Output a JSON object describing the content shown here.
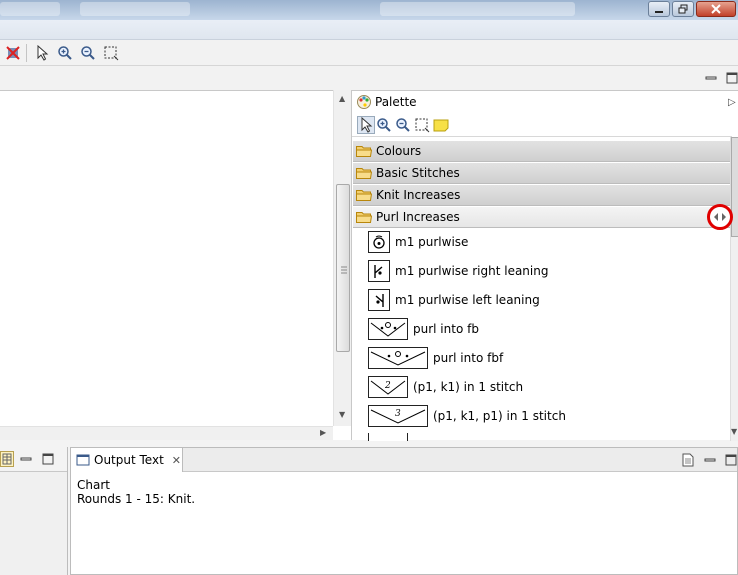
{
  "window": {
    "controls": [
      "minimize",
      "restore",
      "close"
    ]
  },
  "toolbar": {
    "buttons": [
      "delete-icon",
      "select-pointer-icon",
      "zoom-in-icon",
      "zoom-out-icon",
      "marquee-select-icon"
    ]
  },
  "palette": {
    "title": "Palette",
    "tools": [
      "select-pointer-icon",
      "zoom-in-icon",
      "zoom-out-icon",
      "marquee-select-icon",
      "note-icon"
    ],
    "drawers": [
      {
        "label": "Colours",
        "open": false
      },
      {
        "label": "Basic Stitches",
        "open": false
      },
      {
        "label": "Knit Increases",
        "open": false
      },
      {
        "label": "Purl Increases",
        "open": true
      }
    ],
    "entries": [
      {
        "label": "m1 purlwise",
        "symbol": "m1-purlwise-symbol-icon"
      },
      {
        "label": "m1 purlwise right leaning",
        "symbol": "m1-purlwise-right-symbol-icon"
      },
      {
        "label": "m1 purlwise left leaning",
        "symbol": "m1-purlwise-left-symbol-icon"
      },
      {
        "label": "purl into fb",
        "symbol": "purl-into-fb-symbol-icon"
      },
      {
        "label": "purl into fbf",
        "symbol": "purl-into-fbf-symbol-icon"
      },
      {
        "label": "(p1, k1) in 1 stitch",
        "symbol": "p1-k1-in-1-symbol-icon"
      },
      {
        "label": "(p1, k1, p1) in 1 stitch",
        "symbol": "p1-k1-p1-in-1-symbol-icon"
      }
    ]
  },
  "output": {
    "tab_label": "Output Text",
    "lines": [
      "Chart",
      "Rounds 1 - 15: Knit."
    ]
  },
  "colors": {
    "highlight_ring": "#e00000",
    "folder": "#e8b84a"
  }
}
